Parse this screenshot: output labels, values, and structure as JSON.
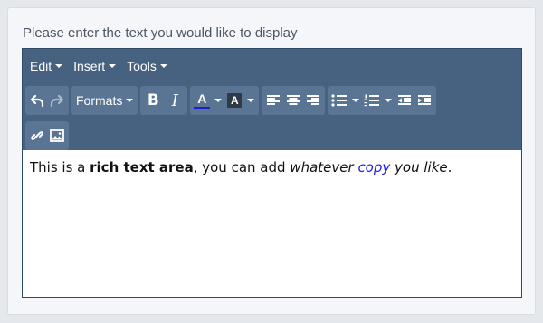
{
  "prompt": "Please enter the text you would like to display",
  "menubar": {
    "items": [
      "Edit",
      "Insert",
      "Tools"
    ]
  },
  "toolbar": {
    "formats_label": "Formats",
    "font_color_letter": "A",
    "bg_color_letter": "A",
    "font_color_value": "#1f1fd0",
    "bold_glyph": "B",
    "italic_glyph": "I"
  },
  "content": {
    "part1": "This is a ",
    "bold": "rich text area",
    "part2": ", you can add ",
    "italic1": "whatever",
    "space1": " ",
    "blue": "copy",
    "italic2": " you like",
    "end": "."
  }
}
